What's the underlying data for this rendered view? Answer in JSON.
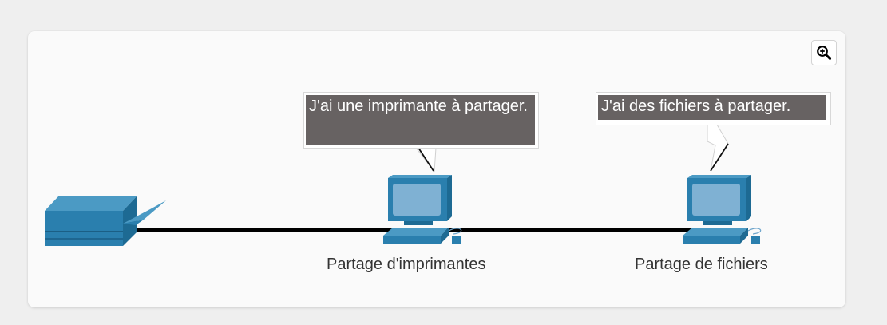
{
  "toolbar": {
    "zoom_icon": "zoom-in-icon"
  },
  "diagram": {
    "nodes": [
      {
        "id": "printer",
        "icon": "printer-icon",
        "label": ""
      },
      {
        "id": "pc1",
        "icon": "computer-icon",
        "label": "Partage d'imprimantes"
      },
      {
        "id": "pc2",
        "icon": "computer-icon",
        "label": "Partage de fichiers"
      }
    ],
    "bubbles": [
      {
        "text": "J'ai une imprimante à partager."
      },
      {
        "text": "J'ai des fichiers à partager."
      }
    ],
    "colors": {
      "device": "#2a7fae",
      "device_dark": "#1d6a93",
      "screen": "#7fb1d3",
      "cable": "#000000",
      "bubble_fill": "#676262"
    }
  }
}
